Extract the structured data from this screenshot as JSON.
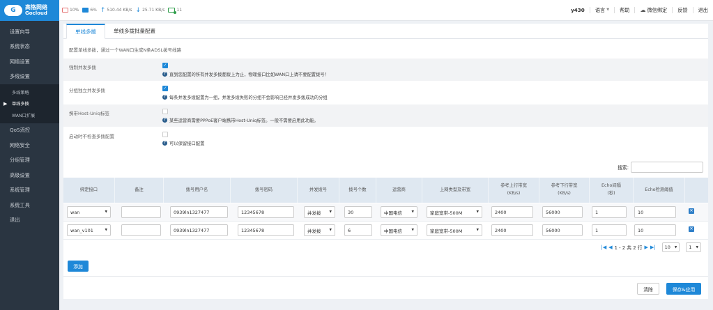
{
  "brand": {
    "name_cn": "高恪网络",
    "name_en": "Gocloud"
  },
  "stats": {
    "cpu": "10%",
    "mem": "6%",
    "up": "510.44 KB/s",
    "down": "25.71 KB/s",
    "conn": "11"
  },
  "topnav": {
    "user": "y430",
    "lang": "语言",
    "help": "帮助",
    "wechat": "微信绑定",
    "feedback": "反馈",
    "logout": "退出"
  },
  "sidebar": {
    "items_top": [
      "设置向导",
      "系统状态",
      "网络设置",
      "多线设置"
    ],
    "sub": [
      "多线策略",
      "单线多拨",
      "WAN口扩展"
    ],
    "items_bottom": [
      "QoS流控",
      "网络安全",
      "分组管理",
      "高级设置",
      "系统管理",
      "系统工具",
      "退出"
    ]
  },
  "tabs": [
    "单线多拨",
    "单线多拨批量配置"
  ],
  "description": "配置单线多拨，通过一个WAN口生成N条ADSL拨号线路",
  "options": [
    {
      "label": "强制并发多拨",
      "hint": "直到您配置的所有并发多拨都拨上为止，物理接口比如WAN口上请不要配置拨号！"
    },
    {
      "label": "分组独立并发多拨",
      "hint": "每条并发多拨配置为一组，并发多拨失败的分组不会影响已经并发多拨成功的分组"
    },
    {
      "label": "携带Host-Uniq标签",
      "hint": "某些运营商需要PPPoE客户端携带Host-Uniq标签。一般不需要启用此功能。"
    },
    {
      "label": "启动时不检查多拨配置",
      "hint": "可以保留接口配置"
    }
  ],
  "search_label": "搜索:",
  "columns": [
    "绑定接口",
    "备注",
    "拨号用户名",
    "拨号密码",
    "并发拨号",
    "拨号个数",
    "运营商",
    "上网类型及带宽",
    "参考上行带宽",
    "(KB/s)",
    "参考下行带宽",
    "(KB/s)",
    "Echo间隔",
    "(秒)",
    "Echo检测阈值"
  ],
  "rows": [
    {
      "iface": "wan",
      "note": "",
      "user": "0939ln1327477",
      "pass": "12345678",
      "mode": "并发拨",
      "count": "30",
      "isp": "中国电信",
      "type": "家庭宽带-500M",
      "up": "2400",
      "down": "56000",
      "echo": "1",
      "thresh": "10"
    },
    {
      "iface": "wan_v101",
      "note": "",
      "user": "0939ln1327477",
      "pass": "12345678",
      "mode": "并发拨",
      "count": "6",
      "isp": "中国电信",
      "type": "家庭宽带-500M",
      "up": "2400",
      "down": "56000",
      "echo": "1",
      "thresh": "10"
    }
  ],
  "pager": {
    "info": "1 - 2 共 2 行",
    "page_size": "10",
    "page": "1"
  },
  "buttons": {
    "add": "添加",
    "clear": "清除",
    "save": "保存&应用"
  }
}
